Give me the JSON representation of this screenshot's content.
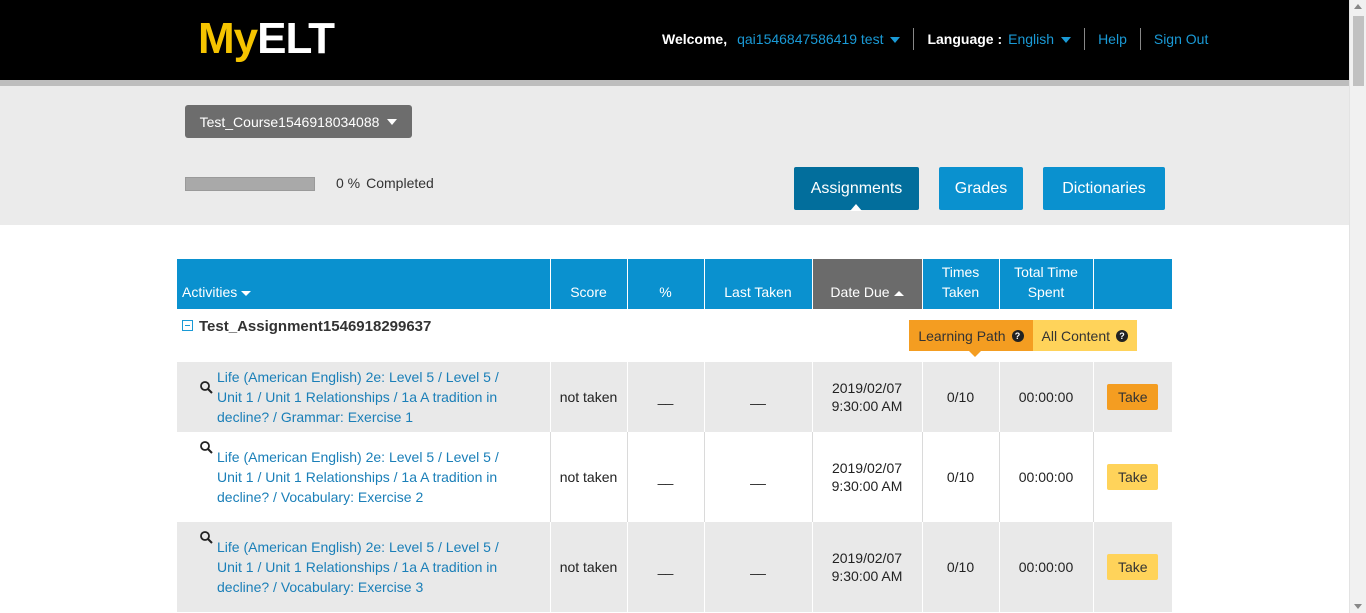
{
  "header": {
    "logo_my": "My",
    "logo_elt": "ELT",
    "welcome_label": "Welcome,",
    "username": "qai1546847586419 test",
    "language_label": "Language :",
    "language_value": "English",
    "help": "Help",
    "sign_out": "Sign Out"
  },
  "course": {
    "selector": "Test_Course1546918034088",
    "progress_percent": 0,
    "progress_value": "0 %",
    "progress_label": "Completed"
  },
  "tabs": {
    "assignments": "Assignments",
    "grades": "Grades",
    "dictionaries": "Dictionaries"
  },
  "table": {
    "headers": {
      "activities": "Activities",
      "score": "Score",
      "percent": "%",
      "last_taken": "Last Taken",
      "date_due": "Date Due",
      "times_taken_1": "Times",
      "times_taken_2": "Taken",
      "total_time_1": "Total Time",
      "total_time_2": "Spent"
    },
    "assignment_title": "Test_Assignment1546918299637",
    "toggle_learning_path": "Learning Path",
    "toggle_all_content": "All Content",
    "rows": [
      {
        "activity": "Life (American English) 2e: Level 5 / Level 5 / Unit 1 / Unit 1 Relationships / 1a A tradition in decline? / Grammar: Exercise 1",
        "score": "not taken",
        "percent": "__",
        "last_taken": "__",
        "date_due_1": "2019/02/07",
        "date_due_2": "9:30:00 AM",
        "times_taken": "0/10",
        "total_time": "00:00:00",
        "action": "Take"
      },
      {
        "activity": "Life (American English) 2e: Level 5 / Level 5 / Unit 1 / Unit 1 Relationships / 1a A tradition in decline? / Vocabulary: Exercise 2",
        "score": "not taken",
        "percent": "__",
        "last_taken": "__",
        "date_due_1": "2019/02/07",
        "date_due_2": "9:30:00 AM",
        "times_taken": "0/10",
        "total_time": "00:00:00",
        "action": "Take"
      },
      {
        "activity": "Life (American English) 2e: Level 5 / Level 5 / Unit 1 / Unit 1 Relationships / 1a A tradition in decline? / Vocabulary: Exercise 3",
        "score": "not taken",
        "percent": "__",
        "last_taken": "__",
        "date_due_1": "2019/02/07",
        "date_due_2": "9:30:00 AM",
        "times_taken": "0/10",
        "total_time": "00:00:00",
        "action": "Take"
      }
    ]
  },
  "colors": {
    "brand_yellow": "#f5c400",
    "primary_blue": "#0a91cf",
    "active_tab": "#026e9c",
    "take_active": "#f49d21",
    "take_inactive": "#ffd35a"
  }
}
